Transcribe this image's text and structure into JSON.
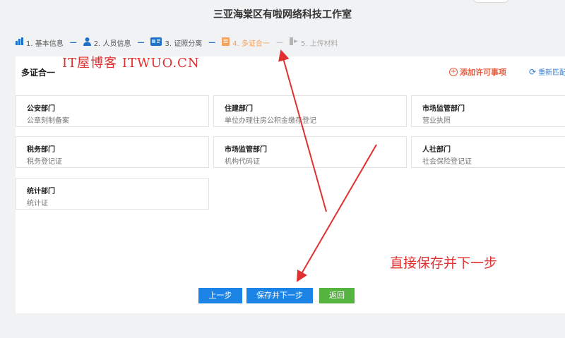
{
  "header": {
    "title": "三亚海棠区有啦网络科技工作室"
  },
  "steps": [
    {
      "label": "1. 基本信息",
      "icon": "bar-chart-icon",
      "state": "done"
    },
    {
      "label": "2. 人员信息",
      "icon": "person-icon",
      "state": "done"
    },
    {
      "label": "3. 证照分离",
      "icon": "id-card-icon",
      "state": "done"
    },
    {
      "label": "4. 多证合一",
      "icon": "document-icon",
      "state": "active"
    },
    {
      "label": "5. 上传材料",
      "icon": "upload-icon",
      "state": "pending"
    }
  ],
  "panel": {
    "title": "多证合一",
    "watermark": "IT屋博客 ITWUO.CN",
    "add_permit_label": "添加许可事项",
    "refresh_label": "重新匹配"
  },
  "cards": [
    {
      "dept": "公安部门",
      "cert": "公章刻制备案"
    },
    {
      "dept": "住建部门",
      "cert": "单位办理住房公积金缴存登记"
    },
    {
      "dept": "市场监管部门",
      "cert": "营业执照"
    },
    {
      "dept": "税务部门",
      "cert": "税务登记证"
    },
    {
      "dept": "市场监管部门",
      "cert": "机构代码证"
    },
    {
      "dept": "人社部门",
      "cert": "社会保险登记证"
    },
    {
      "dept": "统计部门",
      "cert": "统计证"
    }
  ],
  "buttons": {
    "prev": "上一步",
    "save_next": "保存并下一步",
    "back": "返回"
  },
  "annotation": {
    "text": "直接保存并下一步"
  },
  "colors": {
    "primary_blue": "#1b84e6",
    "back_green": "#55b33f",
    "active_step_orange": "#f5a25c",
    "annotation_red": "#e03030",
    "add_permit_red": "#e35c3d"
  }
}
